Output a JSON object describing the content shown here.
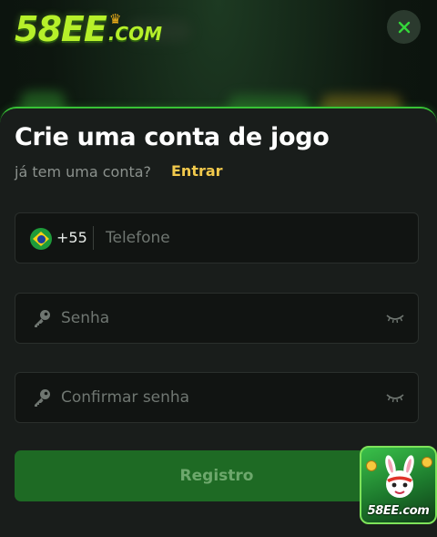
{
  "brand": {
    "logo_main": "58EE",
    "logo_sub": ".COM"
  },
  "modal": {
    "title": "Crie uma conta de jogo",
    "subtitle": "já tem uma conta?",
    "login_link": "Entrar"
  },
  "form": {
    "phone": {
      "country_code": "+55",
      "placeholder": "Telefone",
      "flag": "brazil-flag-icon"
    },
    "password": {
      "placeholder": "Senha",
      "icon": "key-icon",
      "toggle_icon": "eye-closed-icon"
    },
    "confirm_password": {
      "placeholder": "Confirmar senha",
      "icon": "key-icon",
      "toggle_icon": "eye-closed-icon"
    },
    "submit_label": "Registro"
  },
  "promo": {
    "label": "58EE.com"
  },
  "colors": {
    "accent": "#38c236",
    "link": "#f2c94c",
    "button": "#1e6a24",
    "surface": "#191d1b"
  }
}
